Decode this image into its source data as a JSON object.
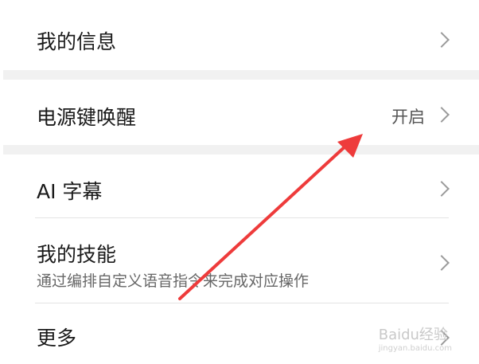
{
  "settings": {
    "my_info": {
      "label": "我的信息"
    },
    "power_key_wake": {
      "label": "电源键唤醒",
      "value": "开启"
    },
    "ai_subtitles": {
      "label": "AI 字幕"
    },
    "my_skills": {
      "label": "我的技能",
      "description": "通过编排自定义语音指令来完成对应操作"
    },
    "more": {
      "label": "更多"
    }
  },
  "watermark": {
    "brand": "Baidu经验",
    "url": "jingyan.baidu.com"
  },
  "annotation": {
    "color": "#ee3b3b"
  }
}
